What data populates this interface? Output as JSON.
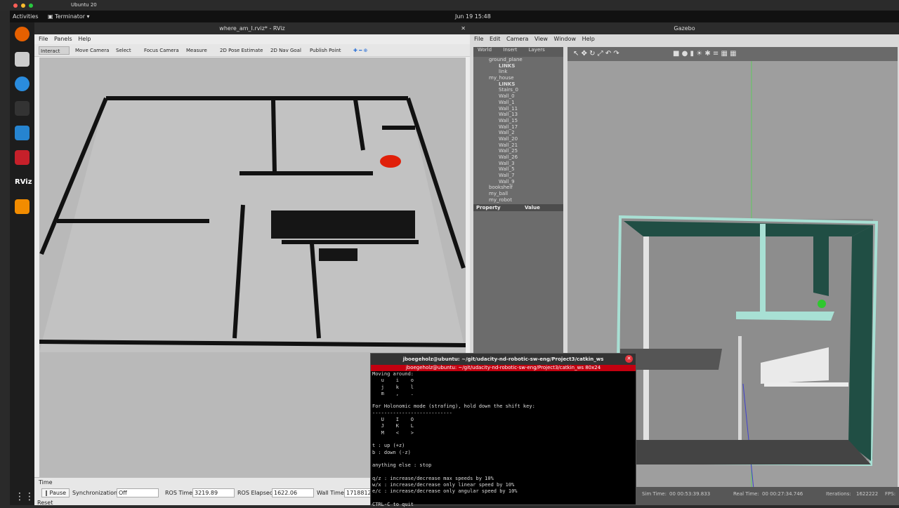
{
  "mac_bar": {
    "title": "Ubuntu 20"
  },
  "top_bar": {
    "activities": "Activities",
    "app": "Terminator",
    "clock": "Jun 19  15:48"
  },
  "rviz": {
    "title": "where_am_I.rviz* - RViz",
    "menu": [
      "File",
      "Panels",
      "Help"
    ],
    "tools": [
      "Interact",
      "Move Camera",
      "Select",
      "Focus Camera",
      "Measure",
      "2D Pose Estimate",
      "2D Nav Goal",
      "Publish Point"
    ],
    "time_panel": {
      "header": "Time",
      "pause": "Pause",
      "sync_label": "Synchronization:",
      "sync_value": "Off",
      "ros_time_label": "ROS Time:",
      "ros_time": "3219.89",
      "ros_elapsed_label": "ROS Elapsed:",
      "ros_elapsed": "1622.06",
      "wall_time_label": "Wall Time:",
      "wall_time": "17188120",
      "reset": "Reset"
    }
  },
  "gazebo": {
    "title": "Gazebo",
    "menu": [
      "File",
      "Edit",
      "Camera",
      "View",
      "Window",
      "Help"
    ],
    "tabs": [
      "World",
      "Insert",
      "Layers"
    ],
    "tree": [
      "ground_plane",
      "LINKS",
      "link",
      "my_house",
      "LINKS",
      "Stairs_0",
      "Wall_0",
      "Wall_1",
      "Wall_11",
      "Wall_13",
      "Wall_15",
      "Wall_17",
      "Wall_2",
      "Wall_20",
      "Wall_21",
      "Wall_25",
      "Wall_26",
      "Wall_3",
      "Wall_5",
      "Wall_7",
      "Wall_9",
      "bookshelf",
      "my_ball",
      "my_robot"
    ],
    "prop_header": {
      "property": "Property",
      "value": "Value"
    },
    "bottom": {
      "sim_time_label": "Sim Time:",
      "sim_time": "00 00:53:39.833",
      "real_time_label": "Real Time:",
      "real_time": "00 00:27:34.746",
      "iterations_label": "Iterations:",
      "iterations": "1622222",
      "fps_label": "FPS:"
    }
  },
  "terminal": {
    "title": "jboegeholz@ubuntu: ~/git/udacity-nd-robotic-sw-eng/Project3/catkin_ws",
    "tab": "jboegeholz@ubuntu: ~/git/udacity-nd-robotic-sw-eng/Project3/catkin_ws 80x24",
    "lines": [
      "Moving around:",
      "   u    i    o",
      "   j    k    l",
      "   m    ,    .",
      "",
      "For Holonomic mode (strafing), hold down the shift key:",
      "---------------------------",
      "   U    I    O",
      "   J    K    L",
      "   M    <    >",
      "",
      "t : up (+z)",
      "b : down (-z)",
      "",
      "anything else : stop",
      "",
      "q/z : increase/decrease max speeds by 10%",
      "w/x : increase/decrease only linear speed by 10%",
      "e/c : increase/decrease only angular speed by 10%",
      "",
      "CTRL-C to quit"
    ]
  },
  "colors": {
    "accent": "#c30010",
    "wall_green": "#1f4f45"
  }
}
